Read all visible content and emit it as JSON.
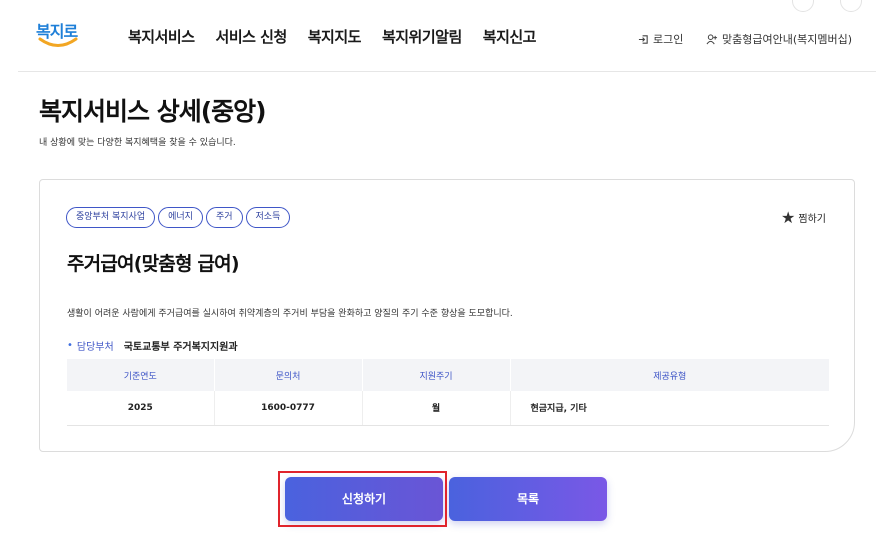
{
  "header": {
    "logo_text": "복지로",
    "nav": [
      "복지서비스",
      "서비스 신청",
      "복지지도",
      "복지위기알림",
      "복지신고"
    ],
    "login_label": "로그인",
    "member_label": "맞춤형급여안내(복지멤버십)"
  },
  "page": {
    "title": "복지서비스 상세(중앙)",
    "subtitle": "내 상황에 맞는 다양한 복지혜택을 찾을 수 있습니다."
  },
  "service": {
    "tags": [
      "중앙부처 복지사업",
      "에너지",
      "주거",
      "저소득"
    ],
    "bookmark_label": "찜하기",
    "title": "주거급여(맞춤형 급여)",
    "description": "생활이 어려운 사람에게 주거급여를 실시하여 취약계층의 주거비 부담을 완화하고 양질의 주기 수준 향상을 도모합니다.",
    "dept_label": "담당부처",
    "dept_value": "국토교통부 주거복지지원과",
    "table": {
      "headers": [
        "기준연도",
        "문의처",
        "지원주기",
        "제공유형"
      ],
      "row": [
        "2025",
        "1600-0777",
        "월",
        "현금지급, 기타"
      ]
    }
  },
  "buttons": {
    "apply": "신청하기",
    "list": "목록"
  },
  "colors": {
    "accent": "#3f56c7",
    "button_gradient_start": "#4a62de",
    "button_gradient_end": "#6a55d6",
    "highlight": "#e0242c"
  }
}
